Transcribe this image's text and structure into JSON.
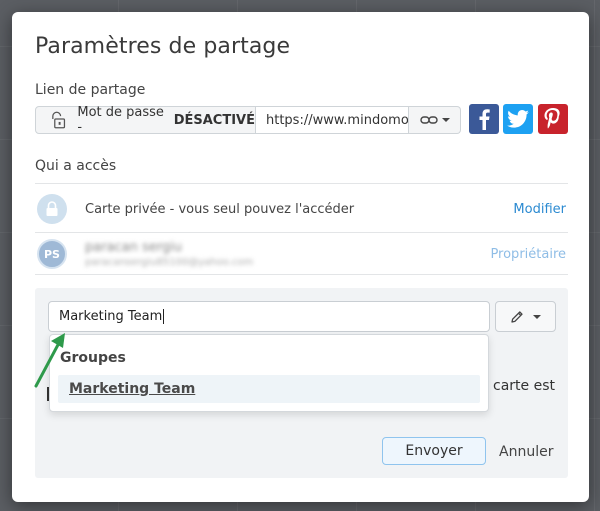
{
  "dialog": {
    "title": "Paramètres de partage"
  },
  "share_link": {
    "label": "Lien de partage",
    "password_prefix": "Mot de passe -",
    "password_state": "DÉSACTIVÉ",
    "url": "https://www.mindomo.com/",
    "social": {
      "facebook_color": "#3b5998",
      "twitter_color": "#1da1f2",
      "pinterest_color": "#c8232c"
    }
  },
  "access": {
    "label": "Qui a accès",
    "rows": [
      {
        "text": "Carte privée - vous seul pouvez l'accéder",
        "action": "Modifier",
        "icon": "lock-icon"
      },
      {
        "avatar_initials": "PS",
        "name": "paracan sergiu",
        "email": "paracansergiu85100@yahoo.com",
        "action": "Propriétaire"
      }
    ]
  },
  "invite": {
    "input_value": "Marketing Team",
    "permission_icon": "pencil-icon",
    "autocomplete": {
      "group_header": "Groupes",
      "items": [
        "Marketing Team"
      ]
    },
    "partial_text": "carte est",
    "send_label": "Envoyer",
    "cancel_label": "Annuler"
  },
  "colors": {
    "link_blue": "#2b8ad1",
    "arrow_green": "#2e9a4b"
  }
}
